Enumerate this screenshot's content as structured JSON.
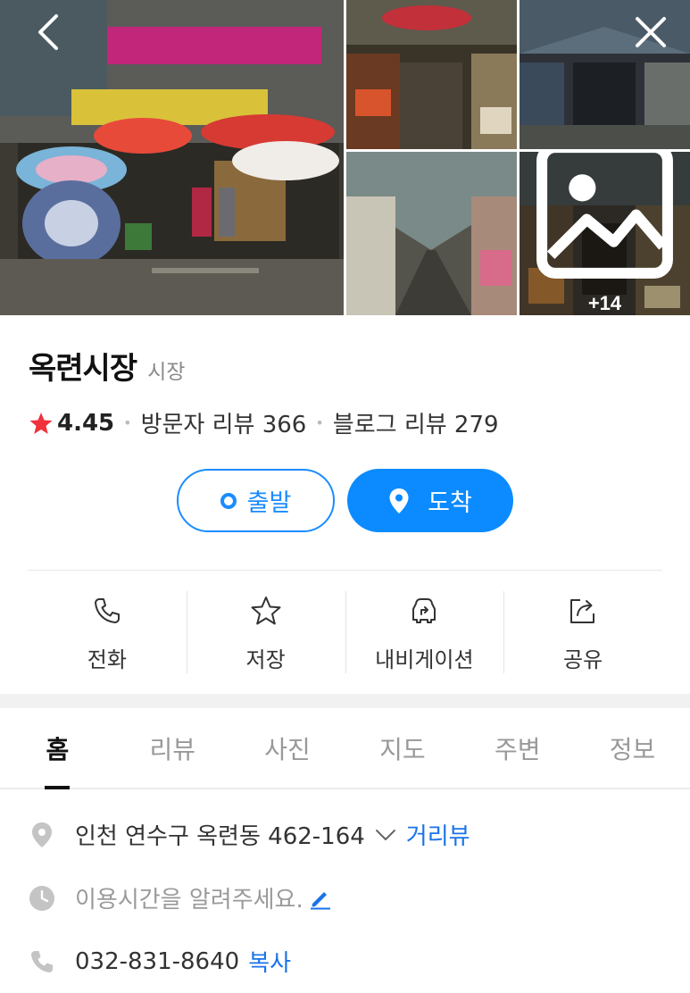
{
  "gallery": {
    "more_count": "+14"
  },
  "place": {
    "name": "옥련시장",
    "category": "시장",
    "rating": "4.45",
    "visitor_reviews": "방문자 리뷰 366",
    "blog_reviews": "블로그 리뷰 279"
  },
  "route": {
    "start_label": "출발",
    "arrive_label": "도착"
  },
  "actions": [
    {
      "label": "전화",
      "icon": "phone-icon"
    },
    {
      "label": "저장",
      "icon": "star-outline-icon"
    },
    {
      "label": "내비게이션",
      "icon": "car-navigation-icon"
    },
    {
      "label": "공유",
      "icon": "share-icon"
    }
  ],
  "tabs": [
    "홈",
    "리뷰",
    "사진",
    "지도",
    "주변",
    "정보"
  ],
  "active_tab": "홈",
  "info": {
    "address": "인천 연수구 옥련동 462-164",
    "street_view": "거리뷰",
    "hours_prompt": "이용시간을 알려주세요.",
    "phone": "032-831-8640",
    "copy": "복사"
  },
  "colors": {
    "accent": "#0b8bff",
    "star": "#f0323c",
    "link": "#1a73e8"
  }
}
